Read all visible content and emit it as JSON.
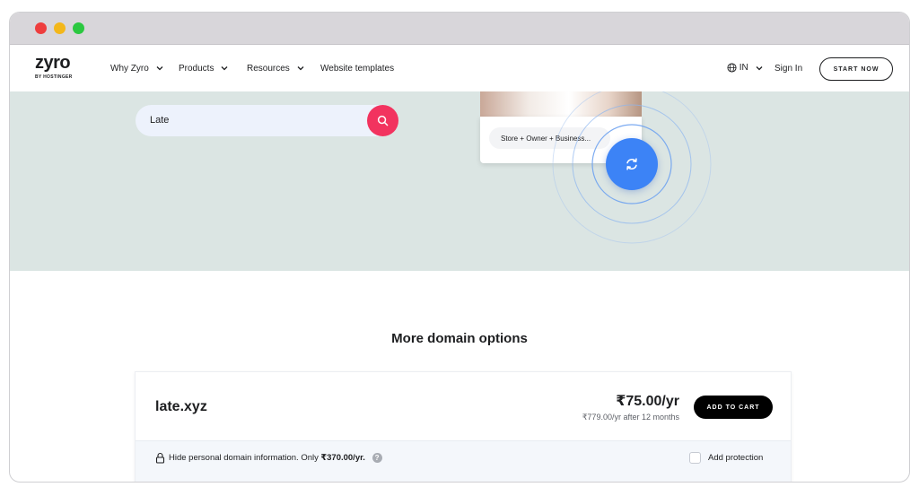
{
  "colors": {
    "accent_search": "#f2335f",
    "accent_refresh": "#3c83f6",
    "hero_background": "#dbe5e3",
    "text_primary": "#1d1e20",
    "button_dark": "#000000"
  },
  "window": {
    "controls": [
      "close",
      "minimize",
      "maximize"
    ]
  },
  "nav": {
    "logo": "zyro",
    "logo_sub": "BY HOSTINGER",
    "items": [
      {
        "label": "Why Zyro",
        "dropdown": true
      },
      {
        "label": "Products",
        "dropdown": true
      },
      {
        "label": "Resources",
        "dropdown": true
      },
      {
        "label": "Website templates",
        "dropdown": false
      }
    ],
    "language": "IN",
    "language_icon": "globe-icon",
    "signin": "Sign In",
    "start_now": "START NOW"
  },
  "hero": {
    "search_value": "Late",
    "search_icon": "search-icon",
    "suggestion": "Store + Owner + Business...",
    "refresh_icon": "refresh-icon"
  },
  "domain_options": {
    "title": "More domain options",
    "results": [
      {
        "name": "late.xyz",
        "price": "₹75.00/yr",
        "renewal": "₹779.00/yr after 12 months",
        "cta": "ADD TO CART",
        "privacy_text": "Hide personal domain information. Only ",
        "privacy_price": "₹370.00/yr.",
        "protection_label": "Add protection",
        "protection_checked": false
      }
    ]
  }
}
